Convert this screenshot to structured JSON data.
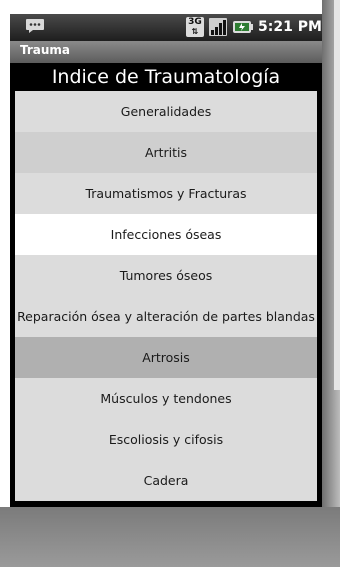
{
  "status_bar": {
    "network_badge": "3G",
    "time": "5:21 PM",
    "icons": [
      "chat-notification-icon",
      "3g-icon",
      "signal-icon",
      "battery-charging-icon"
    ]
  },
  "title_bar": {
    "title": "Trauma"
  },
  "header": {
    "title": "Indice de Traumatología"
  },
  "menu": {
    "items": [
      {
        "label": "Generalidades",
        "shade": "light"
      },
      {
        "label": "Artritis",
        "shade": "mid"
      },
      {
        "label": "Traumatismos y Fracturas",
        "shade": "light"
      },
      {
        "label": "Infecciones óseas",
        "shade": "white"
      },
      {
        "label": "Tumores óseos",
        "shade": "light"
      },
      {
        "label": "Reparación ósea y alteración de partes blandas",
        "shade": "light"
      },
      {
        "label": "Artrosis",
        "shade": "dark"
      },
      {
        "label": "Músculos y tendones",
        "shade": "light"
      },
      {
        "label": "Escoliosis y cifosis",
        "shade": "light"
      },
      {
        "label": "Cadera",
        "shade": "light"
      }
    ]
  },
  "colors": {
    "header_bg": "#000000",
    "item_light": "#dcdcdc",
    "item_mid": "#cfcfcf",
    "item_selected": "#ffffff",
    "item_dark": "#b0b0b0"
  }
}
